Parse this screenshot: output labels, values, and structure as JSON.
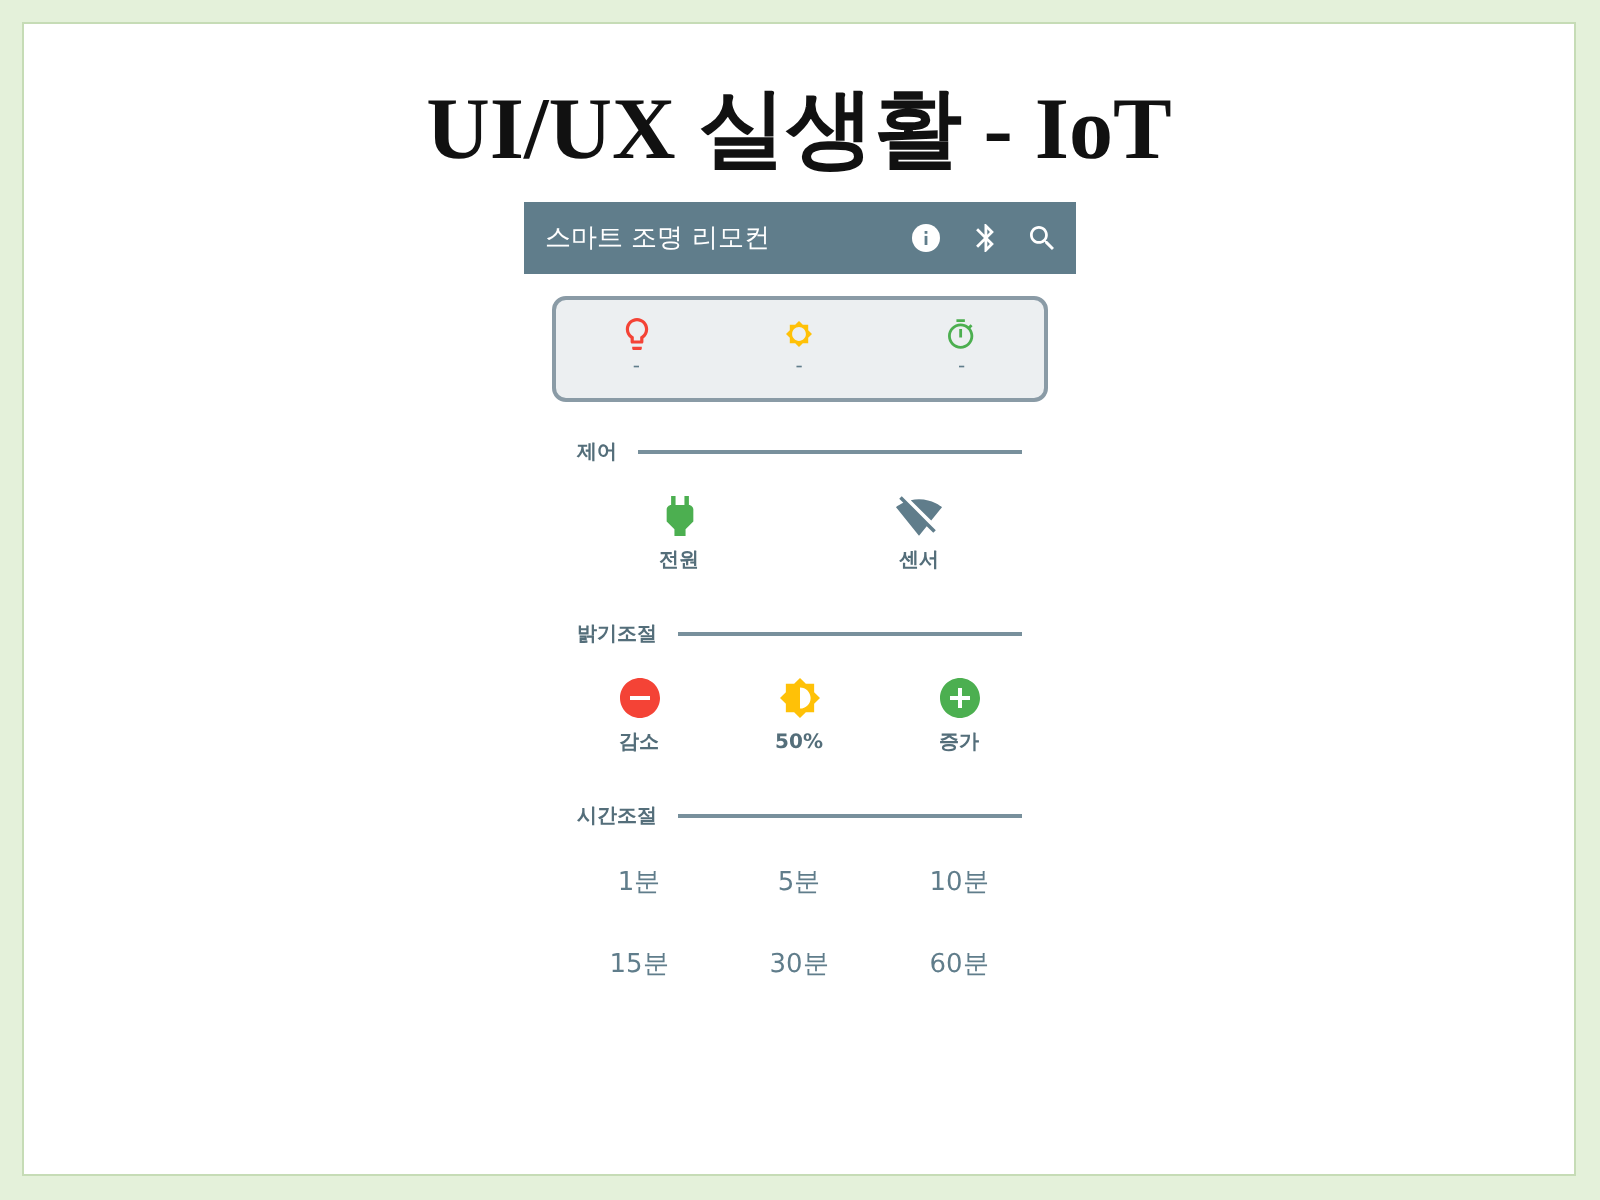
{
  "slide_title": "UI/UX 실생활 - IoT",
  "app_bar": {
    "title": "스마트 조명 리모컨",
    "actions": [
      {
        "kind": "info"
      },
      {
        "kind": "bluetooth"
      },
      {
        "kind": "search"
      }
    ]
  },
  "status_card": {
    "items": [
      {
        "kind": "bulb",
        "color": "#f44336",
        "value": "-"
      },
      {
        "kind": "sun",
        "color": "#ffc107",
        "value": "-"
      },
      {
        "kind": "timer",
        "color": "#4caf50",
        "value": "-"
      }
    ]
  },
  "sections": [
    {
      "kind": "toggles",
      "title": "제어",
      "items": [
        {
          "kind": "power",
          "label": "전원",
          "on": true
        },
        {
          "kind": "sensor",
          "label": "센서",
          "on": false
        }
      ]
    },
    {
      "kind": "adjust",
      "title": "밝기조절",
      "items": [
        {
          "kind": "decrease",
          "label": "감소",
          "color": "#f44336"
        },
        {
          "kind": "level",
          "label": "50%",
          "color": "#ffc107"
        },
        {
          "kind": "increase",
          "label": "증가",
          "color": "#4caf50"
        }
      ]
    },
    {
      "kind": "options",
      "title": "시간조절",
      "items": [
        "1분",
        "5분",
        "10분",
        "15분",
        "30분",
        "60분"
      ]
    }
  ]
}
